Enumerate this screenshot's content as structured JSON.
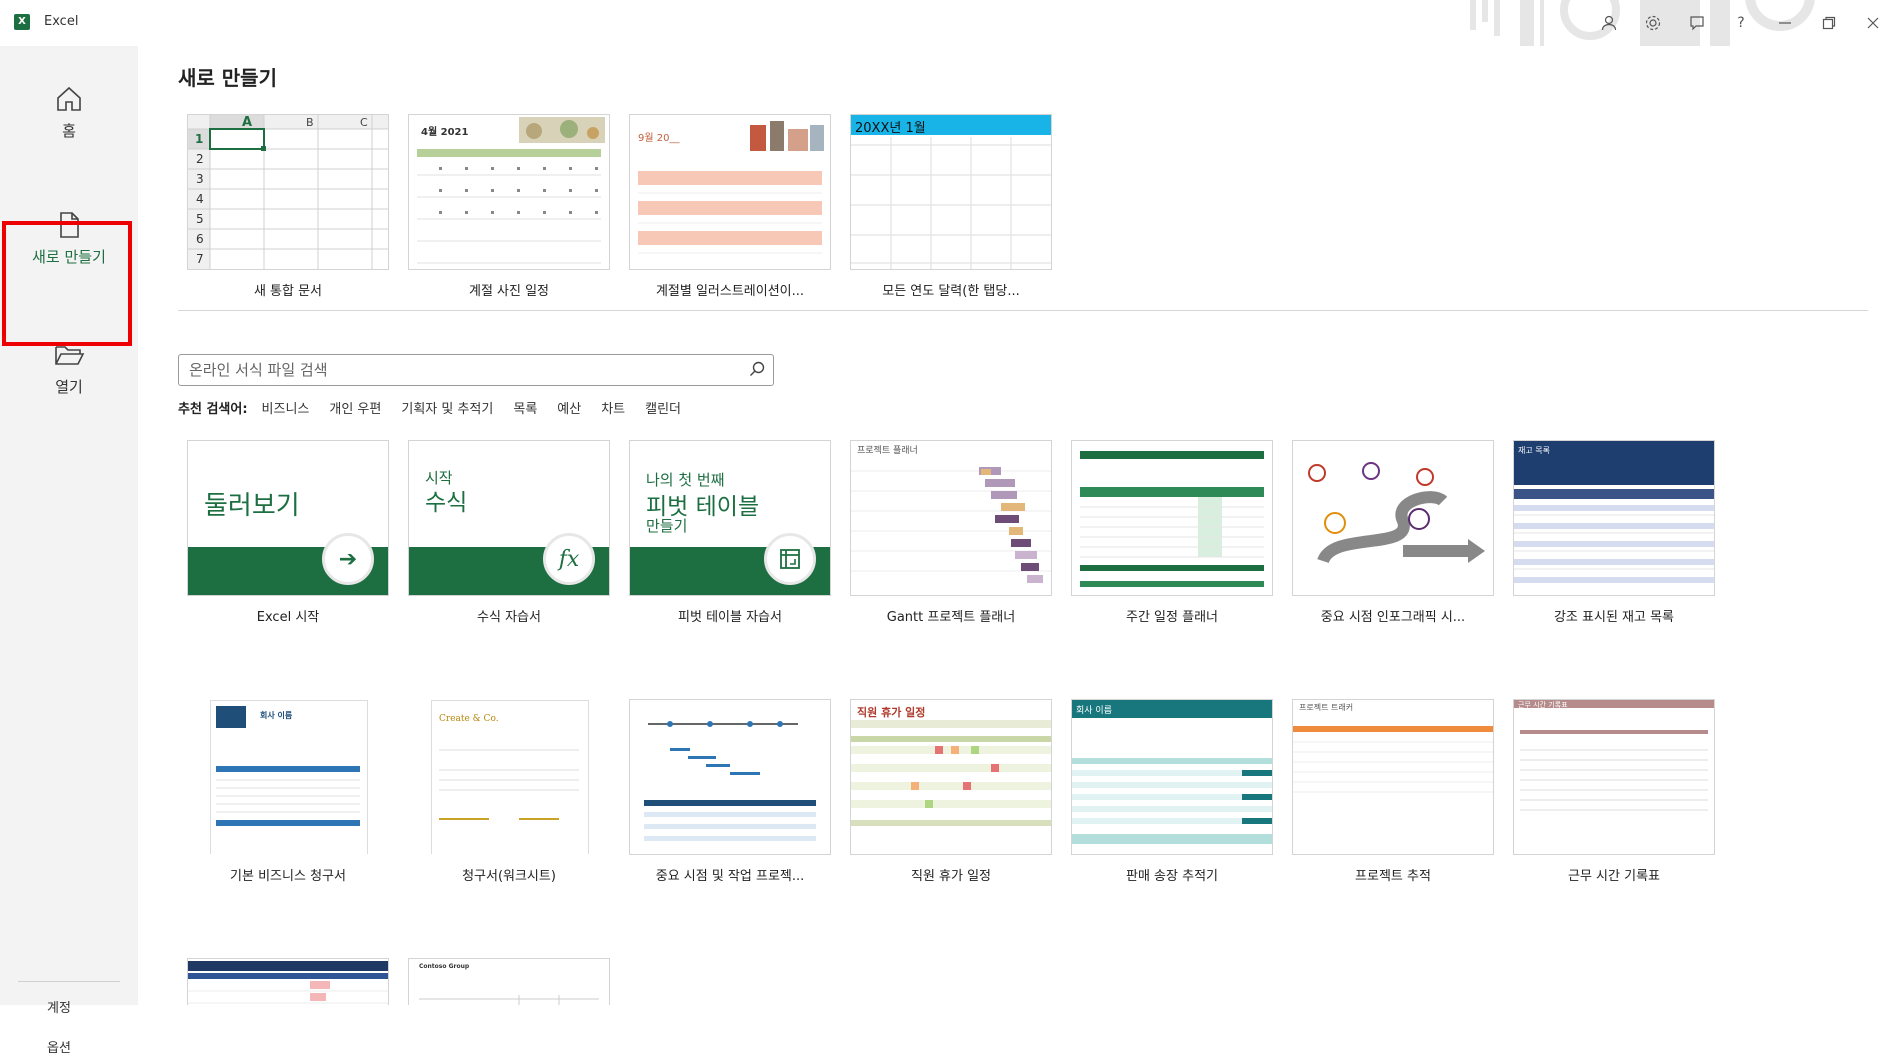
{
  "app": {
    "name": "Excel",
    "logo": "X"
  },
  "sidebar": {
    "items": [
      {
        "label": "홈"
      },
      {
        "label": "새로 만들기"
      },
      {
        "label": "열기"
      }
    ],
    "bottom": [
      {
        "label": "계정"
      },
      {
        "label": "옵션"
      }
    ]
  },
  "main": {
    "title": "새로 만들기",
    "featured": [
      {
        "label": "새 통합 문서"
      },
      {
        "label": "계절 사진 일정"
      },
      {
        "label": "계절별 일러스트레이션이..."
      },
      {
        "label": "모든 연도 달력(한 탭당..."
      }
    ],
    "search": {
      "placeholder": "온라인 서식 파일 검색"
    },
    "suggested": {
      "label": "추천 검색어:",
      "items": [
        "비즈니스",
        "개인 우편",
        "기획자 및 추적기",
        "목록",
        "예산",
        "차트",
        "캘린더"
      ]
    },
    "templates_row1": [
      {
        "label": "Excel 시작",
        "thumb_text": "둘러보기"
      },
      {
        "label": "수식 자습서",
        "thumb_text_1": "시작",
        "thumb_text_2": "수식"
      },
      {
        "label": "피벗 테이블 자습서",
        "thumb_text_1": "나의 첫 번째",
        "thumb_text_2": "피벗 테이블",
        "thumb_text_3": "만들기"
      },
      {
        "label": "Gantt 프로젝트 플래너",
        "thumb_text": "프로젝트 플래너"
      },
      {
        "label": "주간 일정 플래너"
      },
      {
        "label": "중요 시점 인포그래픽 시..."
      },
      {
        "label": "강조 표시된 재고 목록",
        "thumb_text": "재고 목록"
      }
    ],
    "templates_row2": [
      {
        "label": "기본 비즈니스 청구서",
        "thumb_text": "회사 이름"
      },
      {
        "label": "청구서(워크시트)",
        "thumb_text": "Create & Co."
      },
      {
        "label": "중요 시점 및 작업 프로젝..."
      },
      {
        "label": "직원 휴가 일정",
        "thumb_text": "직원 휴가 일정"
      },
      {
        "label": "판매 송장 추적기",
        "thumb_text": "회사 이름"
      },
      {
        "label": "프로젝트 추적",
        "thumb_text": "프로젝트 트래커"
      },
      {
        "label": "근무 시간 기록표",
        "thumb_text": "근무 시간 기록표"
      }
    ],
    "templates_row3": [
      {
        "label": ""
      },
      {
        "label": "",
        "thumb_text": "Contoso Group"
      }
    ],
    "grid": {
      "cols": [
        "A",
        "B",
        "C"
      ],
      "rows": [
        "1",
        "2",
        "3",
        "4",
        "5",
        "6",
        "7"
      ]
    },
    "calendars": {
      "c1": "4월 2021",
      "c2": "9월 20__",
      "c3": "20XX년 1월"
    }
  },
  "colors": {
    "accent": "#1d6f42",
    "highlight": "#e00000"
  }
}
